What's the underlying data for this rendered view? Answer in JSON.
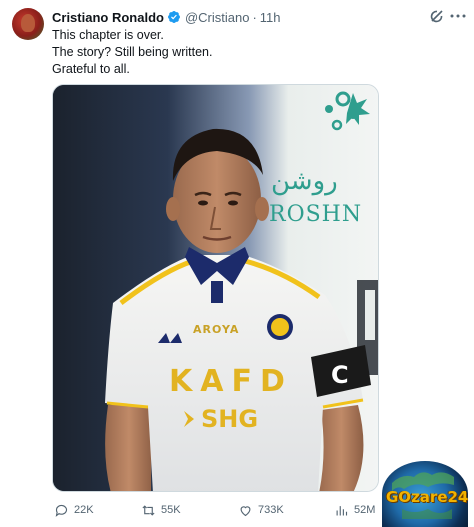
{
  "author": {
    "name": "Cristiano Ronaldo",
    "handle": "@Cristiano",
    "separator": "·",
    "time": "11h"
  },
  "tweet": {
    "lines": [
      "This chapter is over.",
      "The story? Still being written.",
      "Grateful to all."
    ]
  },
  "media": {
    "description_icon": "photo-icon",
    "jersey": {
      "sponsor_top": "AROYA",
      "sponsor_main": "KAFD",
      "sponsor_sub": "SHG",
      "captain_band": "C"
    },
    "backdrop": {
      "arabic": "روشن",
      "brand": "ROSHN"
    }
  },
  "actions": {
    "replies": "22K",
    "reposts": "55K",
    "likes": "733K",
    "views": "52M"
  },
  "watermark": {
    "text": "GOzare24"
  },
  "colors": {
    "text_primary": "#0f1419",
    "text_secondary": "#536471",
    "verified": "#1d9bf0",
    "border": "#cfd9de"
  }
}
